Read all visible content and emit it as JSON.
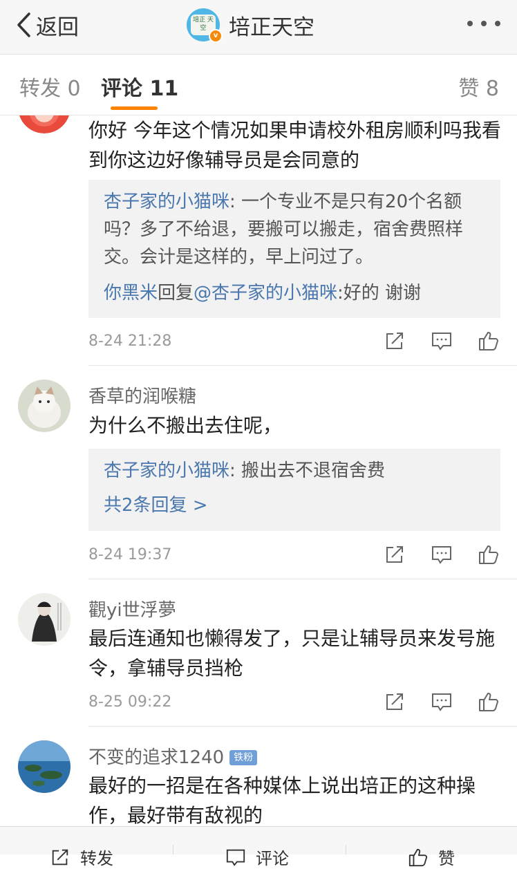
{
  "nav": {
    "back_label": "返回",
    "title": "培正天空",
    "logo_text": "培正 天空"
  },
  "tabs": {
    "forward": "转发 0",
    "comments": "评论 11",
    "likes": "赞 8",
    "active_color": "#ff8200"
  },
  "comments": [
    {
      "text": "你好 今年这个情况如果申请校外租房顺利吗我看到你这边好像辅导员是会同意的",
      "replies": [
        {
          "user": "杏子家的小猫咪",
          "text": ": 一个专业不是只有20个名额吗？多了不给退，要搬可以搬走，宿舍费照样交。会计是这样的，早上问过了。"
        },
        {
          "user": "你黑米",
          "mid": "回复",
          "at": "@杏子家的小猫咪",
          "text": ":好的 谢谢"
        }
      ],
      "time": "8-24 21:28"
    },
    {
      "user": "香草的润喉糖",
      "text": "为什么不搬出去住呢，",
      "replies": [
        {
          "user": "杏子家的小猫咪",
          "text": ": 搬出去不退宿舍费"
        }
      ],
      "more_replies": "共2条回复 >",
      "time": "8-24 19:37"
    },
    {
      "user": "觀yi世浮夢",
      "text": "最后连通知也懒得发了，只是让辅导员来发号施令，拿辅导员挡枪",
      "time": "8-25 09:22"
    },
    {
      "user": "不变的追求1240",
      "badge": "铁粉",
      "text": "最好的一招是在各种媒体上说出培正的这种操作，最好带有敌视的"
    }
  ],
  "bottom": {
    "forward": "转发",
    "comment": "评论",
    "like": "赞"
  },
  "colors": {
    "link": "#4a77ad",
    "badge": "#6f9ed8",
    "vip": "#f38b0c"
  }
}
